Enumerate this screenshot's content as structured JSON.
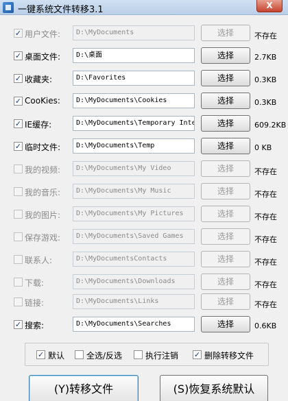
{
  "window": {
    "title": "一键系统文件转移3.1",
    "close_glyph": "X"
  },
  "select_label": "选择",
  "check_glyph": "✓",
  "rows": [
    {
      "label": "用户文件:",
      "path": "D:\\MyDocuments",
      "status": "不存在",
      "checked": true,
      "enabled": false
    },
    {
      "label": "桌面文件:",
      "path": "D:\\桌面",
      "status": "2.7KB",
      "checked": true,
      "enabled": true
    },
    {
      "label": "收藏夹:",
      "path": "D:\\Favorites",
      "status": "0.3KB",
      "checked": true,
      "enabled": true
    },
    {
      "label": "CooKies:",
      "path": "D:\\MyDocuments\\Cookies",
      "status": "0.3KB",
      "checked": true,
      "enabled": true
    },
    {
      "label": "IE缓存:",
      "path": "D:\\MyDocuments\\Temporary Inte",
      "status": "609.2KB",
      "checked": true,
      "enabled": true
    },
    {
      "label": "临时文件:",
      "path": "D:\\MyDocuments\\Temp",
      "status": "0 KB",
      "checked": true,
      "enabled": true
    },
    {
      "label": "我的视频:",
      "path": "D:\\MyDocuments\\My Video",
      "status": "不存在",
      "checked": false,
      "enabled": false
    },
    {
      "label": "我的音乐:",
      "path": "D:\\MyDocuments\\My Music",
      "status": "不存在",
      "checked": false,
      "enabled": false
    },
    {
      "label": "我的图片:",
      "path": "D:\\MyDocuments\\My Pictures",
      "status": "不存在",
      "checked": false,
      "enabled": false
    },
    {
      "label": "保存游戏:",
      "path": "D:\\MyDocuments\\Saved Games",
      "status": "不存在",
      "checked": false,
      "enabled": false
    },
    {
      "label": "联系人:",
      "path": "D:\\MyDocumentsContacts",
      "status": "不存在",
      "checked": false,
      "enabled": false
    },
    {
      "label": "下载:",
      "path": "D:\\MyDocuments\\Downloads",
      "status": "不存在",
      "checked": false,
      "enabled": false
    },
    {
      "label": "链接:",
      "path": "D:\\MyDocuments\\Links",
      "status": "不存在",
      "checked": false,
      "enabled": false
    },
    {
      "label": "搜索:",
      "path": "D:\\MyDocuments\\Searches",
      "status": "0.6KB",
      "checked": true,
      "enabled": true
    }
  ],
  "options": [
    {
      "label": "默认",
      "checked": true
    },
    {
      "label": "全选/反选",
      "checked": false
    },
    {
      "label": "执行注销",
      "checked": false
    },
    {
      "label": "删除转移文件",
      "checked": true
    }
  ],
  "buttons": {
    "transfer": "(Y)转移文件",
    "restore": "(S)恢复系统默认"
  }
}
